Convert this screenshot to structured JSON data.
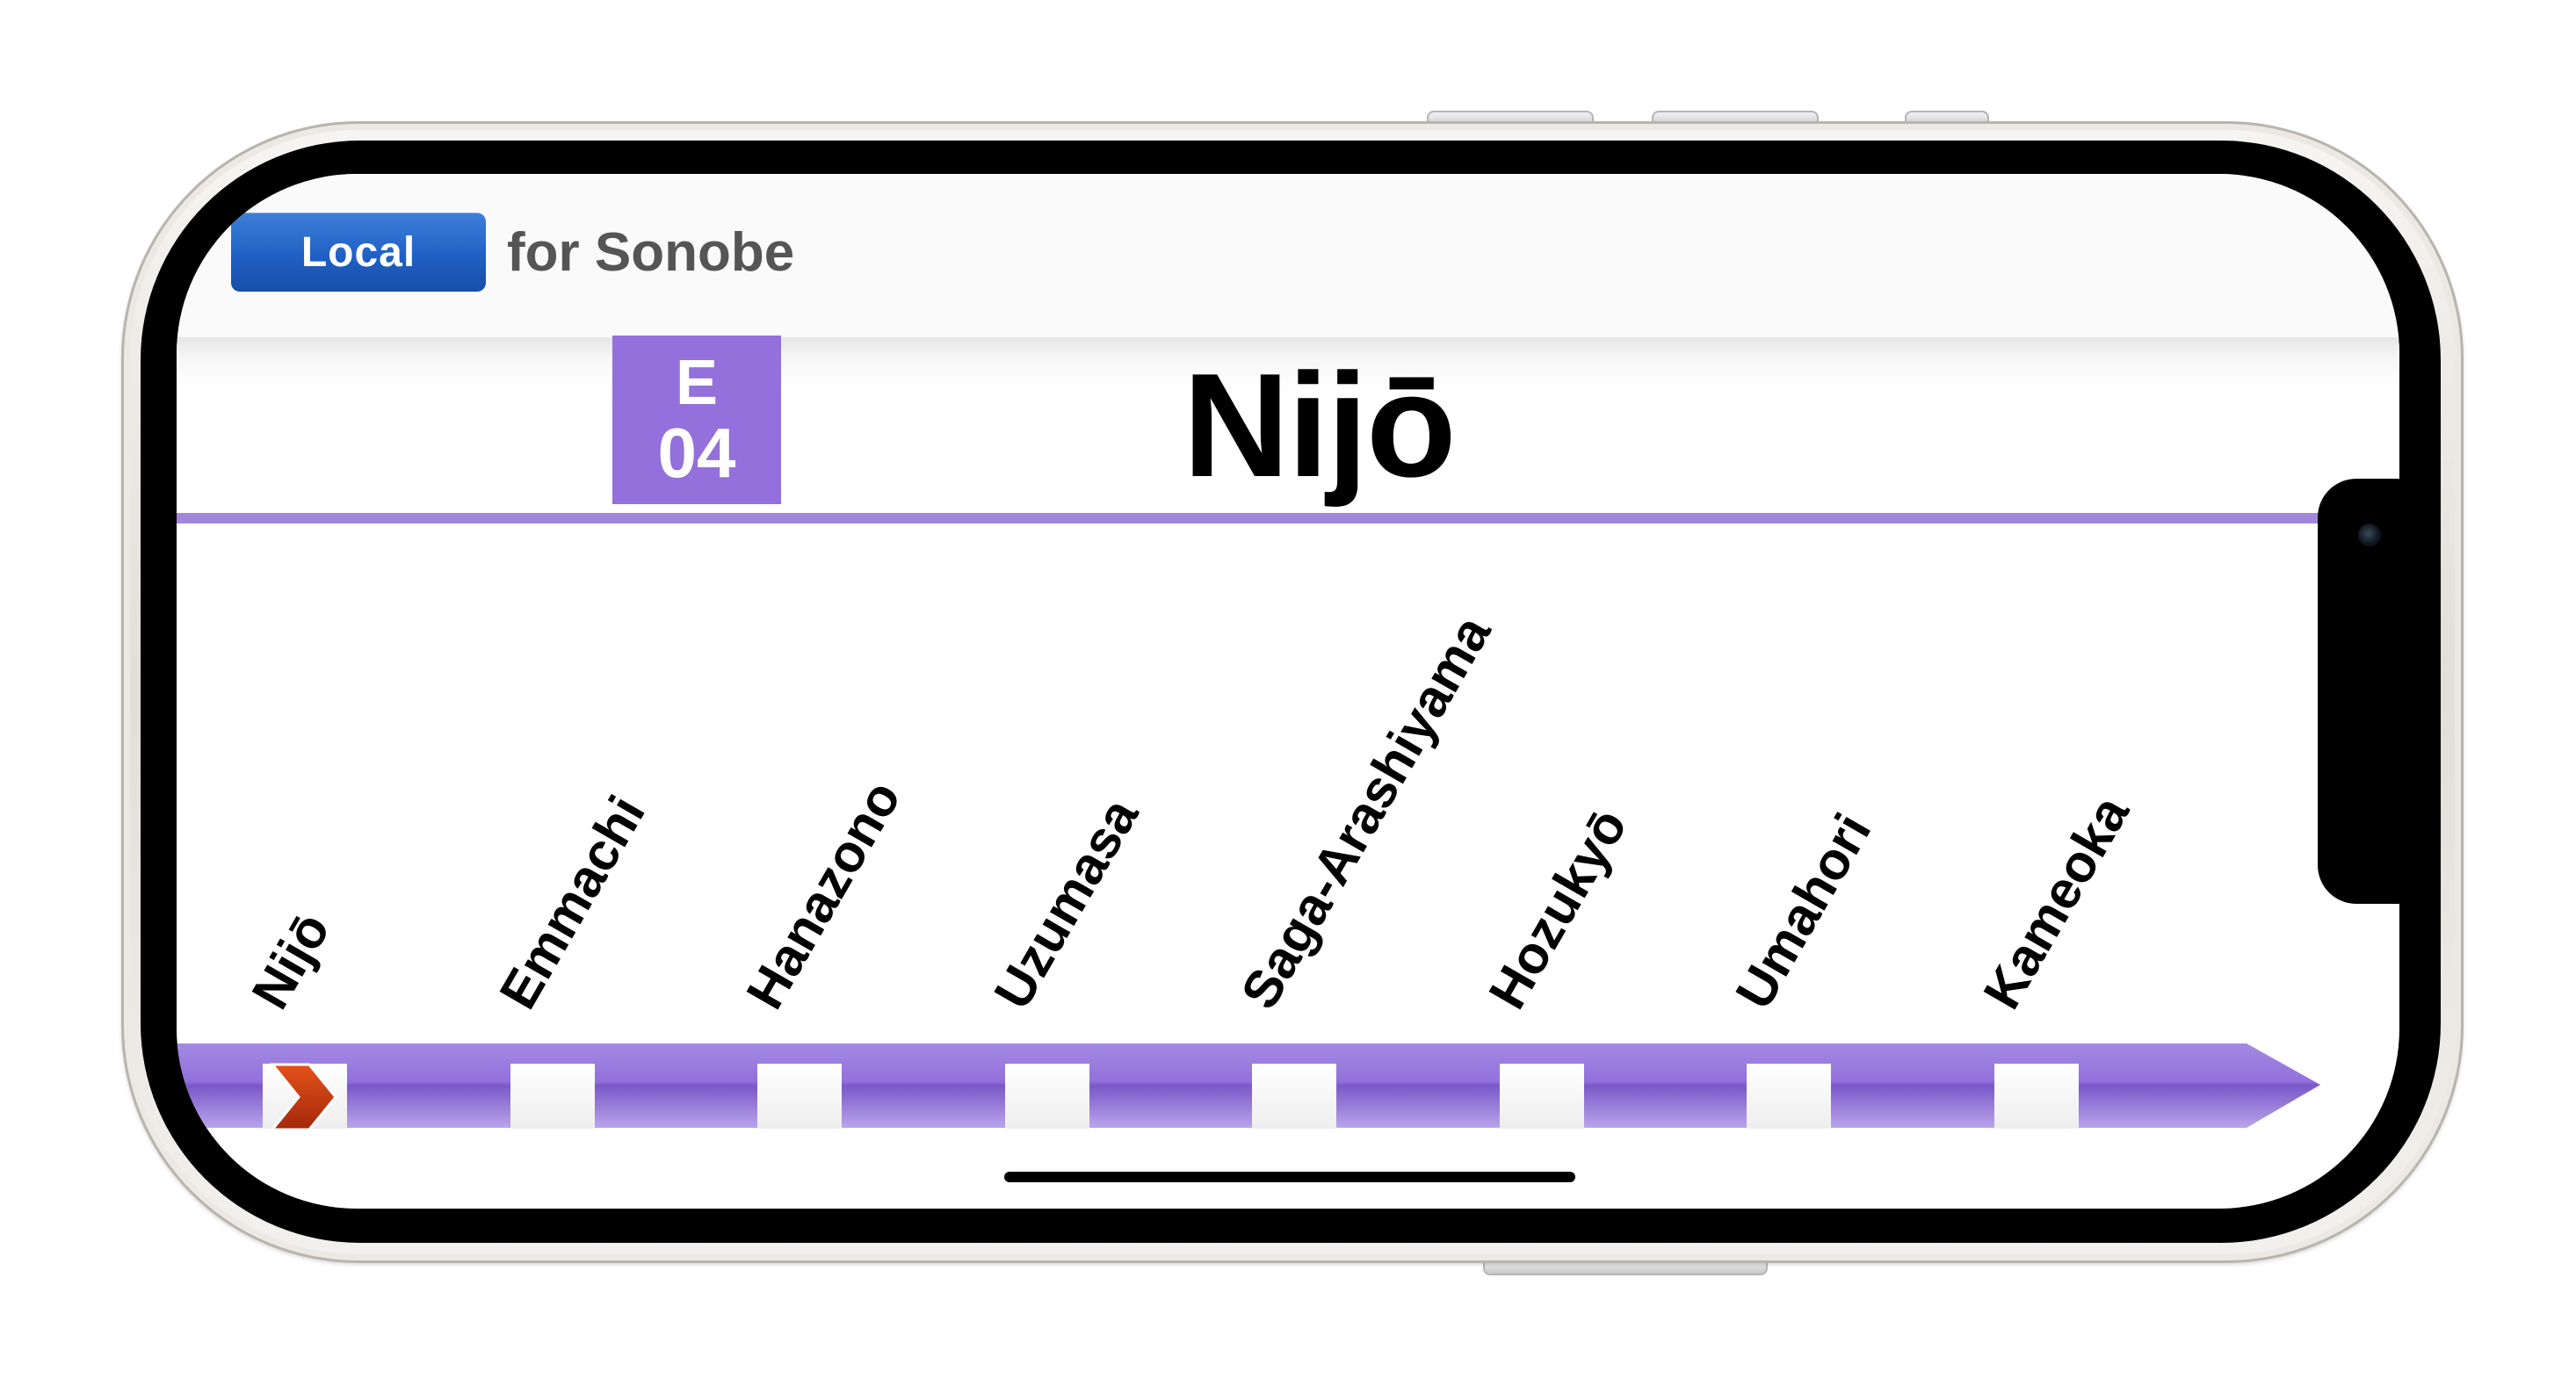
{
  "service": {
    "type_label": "Local",
    "destination": "for Sonobe",
    "badge_color": "#2563c4"
  },
  "current_station": {
    "name": "Nijō",
    "code_letter": "E",
    "code_number": "04",
    "line_color": "#9370db"
  },
  "route": {
    "stops": [
      {
        "name": "Nijō",
        "current": true
      },
      {
        "name": "Emmachi",
        "current": false
      },
      {
        "name": "Hanazono",
        "current": false
      },
      {
        "name": "Uzumasa",
        "current": false
      },
      {
        "name": "Saga-Arashiyama",
        "current": false
      },
      {
        "name": "Hozukyō",
        "current": false
      },
      {
        "name": "Umahori",
        "current": false
      },
      {
        "name": "Kameoka",
        "current": false
      }
    ],
    "current_marker_icon": "chevron-right-icon",
    "marker_color": "#c1390f"
  }
}
